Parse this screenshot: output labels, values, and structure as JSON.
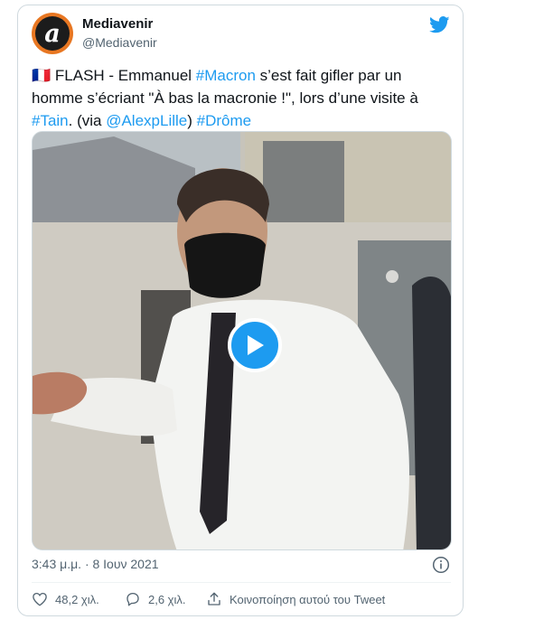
{
  "tweet": {
    "author_name": "Mediavenir",
    "author_handle": "@Mediavenir",
    "avatar_letter": "a",
    "text_parts": {
      "flag": "🇫🇷",
      "p1": " FLASH - Emmanuel ",
      "tag_macron": "#Macron",
      "p2": " s’est fait gifler par un homme s’écriant \"À bas la macronie !\", lors d’une visite à ",
      "tag_tain": "#Tain",
      "p3": ". (via ",
      "mention": "@AlexpLille",
      "p4": ") ",
      "tag_drome": "#Drôme"
    },
    "timestamp": "3:43 μ.μ. · 8 Ιουν 2021"
  },
  "actions": {
    "likes": "48,2 χιλ.",
    "replies": "2,6 χιλ.",
    "share_label": "Κοινοποίηση αυτού του Tweet"
  },
  "colors": {
    "accent": "#1d9bf0",
    "border": "#cfd9de",
    "secondary_text": "#536471"
  }
}
